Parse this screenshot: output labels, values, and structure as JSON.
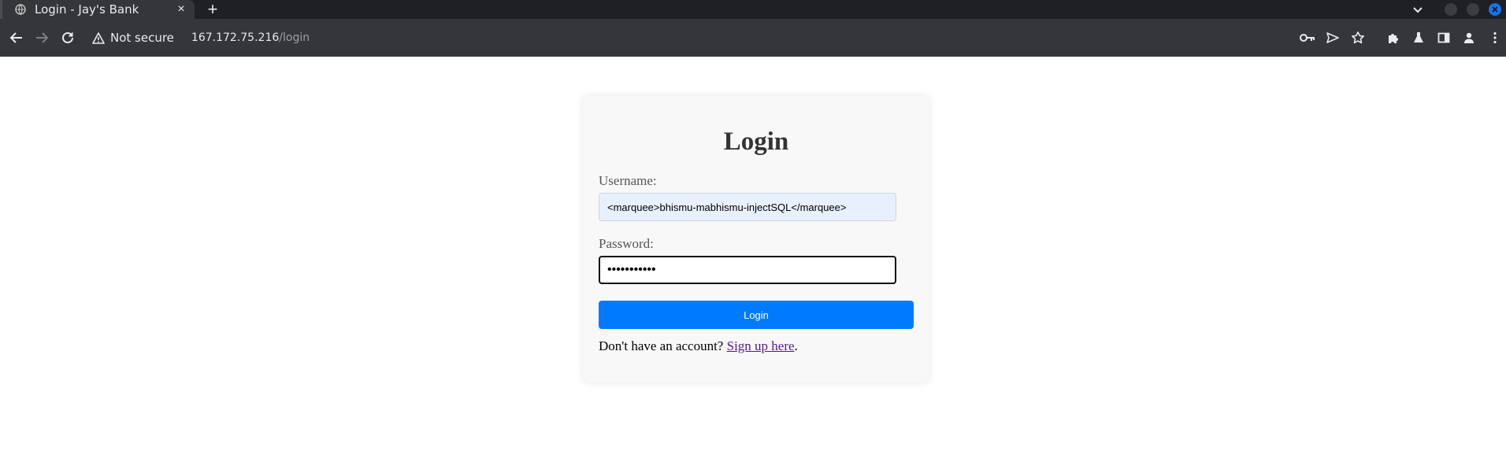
{
  "browser": {
    "tab_title": "Login - Jay's Bank",
    "tab_close": "×",
    "new_tab": "+",
    "security_label": "Not secure",
    "url_host": "167.172.75.216",
    "url_path": "/login"
  },
  "login": {
    "heading": "Login",
    "username_label": "Username:",
    "username_value": "<marquee>bhismu-mabhismu-injectSQL</marquee>",
    "password_label": "Password:",
    "password_value": "•••••••••••",
    "submit_label": "Login",
    "signup_prompt": "Don't have an account?",
    "signup_link": "Sign up here",
    "signup_suffix": "."
  },
  "colors": {
    "primary_button": "#007bff",
    "visited_link": "#551a8b",
    "autofill_bg": "#e8f0fe"
  }
}
